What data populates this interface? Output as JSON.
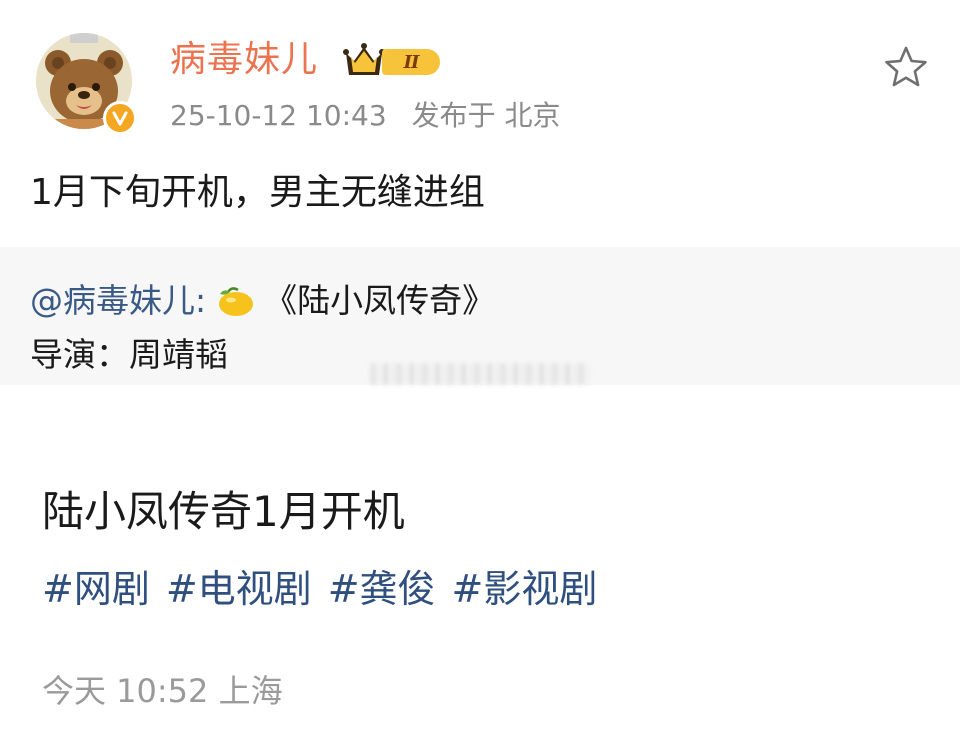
{
  "post": {
    "author": {
      "name": "病毒妹儿",
      "level": "II",
      "avatar": "bear-avatar",
      "verified_icon": "verified-v-icon"
    },
    "time": "25-10-12 10:43",
    "location": "发布于 北京",
    "text": "1月下旬开机，男主无缝进组",
    "favorite_icon": "star-outline-icon",
    "quote": {
      "mention": "@病毒妹儿",
      "colon": ":",
      "emoji": "lemon-icon",
      "title": "《陆小凤传奇》",
      "line2": "导演：周靖韬"
    }
  },
  "article": {
    "title": "陆小凤传奇1月开机",
    "tags": [
      "#网剧",
      "#电视剧",
      "#龚俊",
      "#影视剧"
    ],
    "footer": "今天 10:52 上海"
  },
  "colors": {
    "username": "#eb7350",
    "link": "#3a5a86",
    "tag": "#2f4f7f",
    "meta": "#8a8a8a",
    "quote_bg": "#f7f7f7",
    "badge": "#f7c33a"
  }
}
